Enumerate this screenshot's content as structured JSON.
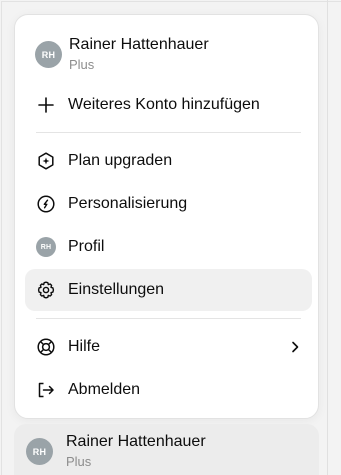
{
  "account": {
    "initials": "RH",
    "name": "Rainer Hattenhauer",
    "tier": "Plus"
  },
  "menu": {
    "add_account": "Weiteres Konto hinzufügen",
    "upgrade_plan": "Plan upgraden",
    "personalization": "Personalisierung",
    "profile": "Profil",
    "settings": "Einstellungen",
    "help": "Hilfe",
    "logout": "Abmelden"
  },
  "icons": {
    "add_account": "plus-icon",
    "upgrade_plan": "upgrade-hexagon-icon",
    "personalization": "personalization-circle-icon",
    "profile": "avatar-icon",
    "settings": "gear-icon",
    "help": "lifebuoy-icon",
    "help_chevron": "chevron-right-icon",
    "logout": "logout-arrow-icon"
  },
  "colors": {
    "avatar_bg": "#9aa3a8",
    "active_bg": "#f0f0f0",
    "muted_text": "#8d8d8d"
  }
}
